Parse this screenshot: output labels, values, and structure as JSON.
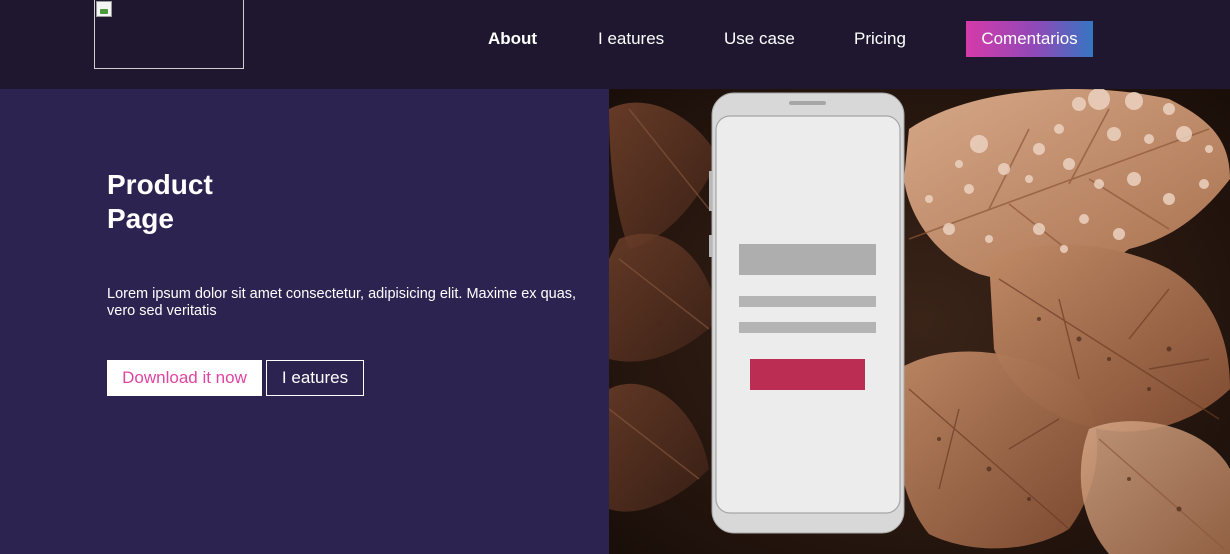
{
  "nav": {
    "links": [
      {
        "label": "About",
        "active": true
      },
      {
        "label": "I eatures",
        "active": false
      },
      {
        "label": "Use case",
        "active": false
      },
      {
        "label": "Pricing",
        "active": false
      }
    ],
    "cta_label": "Comentarios"
  },
  "hero": {
    "title_line1": "Product",
    "title_line2": "Page",
    "text": "Lorem ipsum dolor sit amet consectetur, adipisicing elit. Maxime ex quas, vero sed veritatis",
    "download_label": "Download it now",
    "features_label": "I eatures"
  },
  "colors": {
    "nav_bg": "#1e172f",
    "hero_bg": "#2c2350",
    "accent_pink": "#e044a0",
    "cta_gradient": [
      "#d63aa9",
      "#3676c2"
    ],
    "phone_button": "#bb2d52"
  },
  "icons": {
    "logo": "broken-image-icon"
  }
}
